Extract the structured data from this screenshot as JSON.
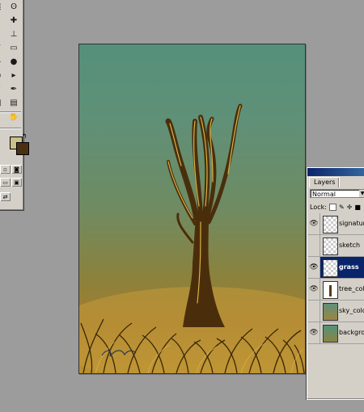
{
  "tools": {
    "items": [
      {
        "icon": "marquee-icon",
        "glyph": "⬚"
      },
      {
        "icon": "lasso-icon",
        "glyph": "ʘ"
      },
      {
        "icon": "crop-icon",
        "glyph": "⌗"
      },
      {
        "icon": "healing-brush-icon",
        "glyph": "✚"
      },
      {
        "icon": "brush-icon",
        "glyph": "✎"
      },
      {
        "icon": "clone-stamp-icon",
        "glyph": "⊥"
      },
      {
        "icon": "history-brush-icon",
        "glyph": "↺"
      },
      {
        "icon": "eraser-icon",
        "glyph": "▭"
      },
      {
        "icon": "paint-bucket-icon",
        "glyph": "◆"
      },
      {
        "icon": "blur-icon",
        "glyph": "●"
      },
      {
        "icon": "dodge-icon",
        "glyph": "◐"
      },
      {
        "icon": "path-selection-icon",
        "glyph": "▸"
      },
      {
        "icon": "type-icon",
        "glyph": "T"
      },
      {
        "icon": "pen-icon",
        "glyph": "✒"
      },
      {
        "icon": "shape-icon",
        "glyph": "□"
      },
      {
        "icon": "notes-icon",
        "glyph": "▤"
      },
      {
        "icon": "eyedropper-icon",
        "glyph": "⁄"
      },
      {
        "icon": "hand-icon",
        "glyph": "✋"
      },
      {
        "icon": "zoom-icon",
        "glyph": "🔍"
      }
    ],
    "foreground_color": "#c9c08a",
    "background_color": "#4b2f12",
    "swap_glyph": "↰"
  },
  "layers_panel": {
    "tab_label": "Layers",
    "blend_mode": "Normal",
    "lock_label": "Lock:",
    "layers": [
      {
        "name": "signature",
        "visible": true,
        "selected": false,
        "thumb": "transparent"
      },
      {
        "name": "sketch",
        "visible": false,
        "selected": false,
        "thumb": "transparent"
      },
      {
        "name": "grass",
        "visible": true,
        "selected": true,
        "thumb": "transparent"
      },
      {
        "name": "tree_colou",
        "visible": true,
        "selected": false,
        "thumb": "tree"
      },
      {
        "name": "sky_colou",
        "visible": false,
        "selected": false,
        "thumb": "sky"
      },
      {
        "name": "backgrou",
        "visible": true,
        "selected": false,
        "thumb": "bg"
      }
    ]
  },
  "colors": {
    "selection": "#0a246a",
    "panel": "#d4d0c8",
    "workspace": "#9c9c9c"
  }
}
